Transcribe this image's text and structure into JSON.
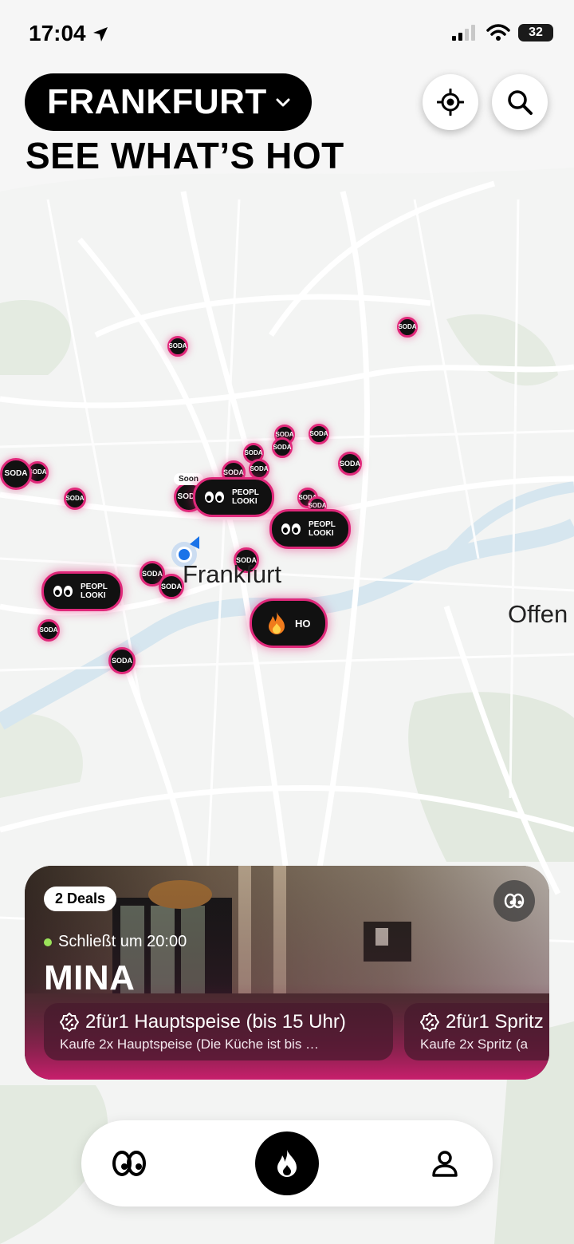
{
  "status_bar": {
    "time": "17:04",
    "battery": "32"
  },
  "header": {
    "city": "FRANKFURT",
    "headline": "SEE WHAT’S HOT"
  },
  "map": {
    "soda_label_top": "SO",
    "soda_label_bottom": "DA",
    "soda_short": "SO DA",
    "people_label_1": "PEOPL",
    "people_label_2": "LOOKI",
    "hot_label": "HO",
    "soon_label": "Soon",
    "city_label": "Frankfurt",
    "offenbach_label": "Offen"
  },
  "venue_card": {
    "deals_count": "2 Deals",
    "closes": "Schließt um 20:00",
    "name": "MINA",
    "deals": [
      {
        "title": "2für1 Hauptspeise (bis 15 Uhr)",
        "subtitle": "Kaufe 2x Hauptspeise (Die Küche ist bis …"
      },
      {
        "title": "2für1 Spritz",
        "subtitle": "Kaufe 2x Spritz (a"
      }
    ]
  },
  "colors": {
    "accent": "#e0287a",
    "dark": "#111111",
    "open": "#9be35a"
  }
}
